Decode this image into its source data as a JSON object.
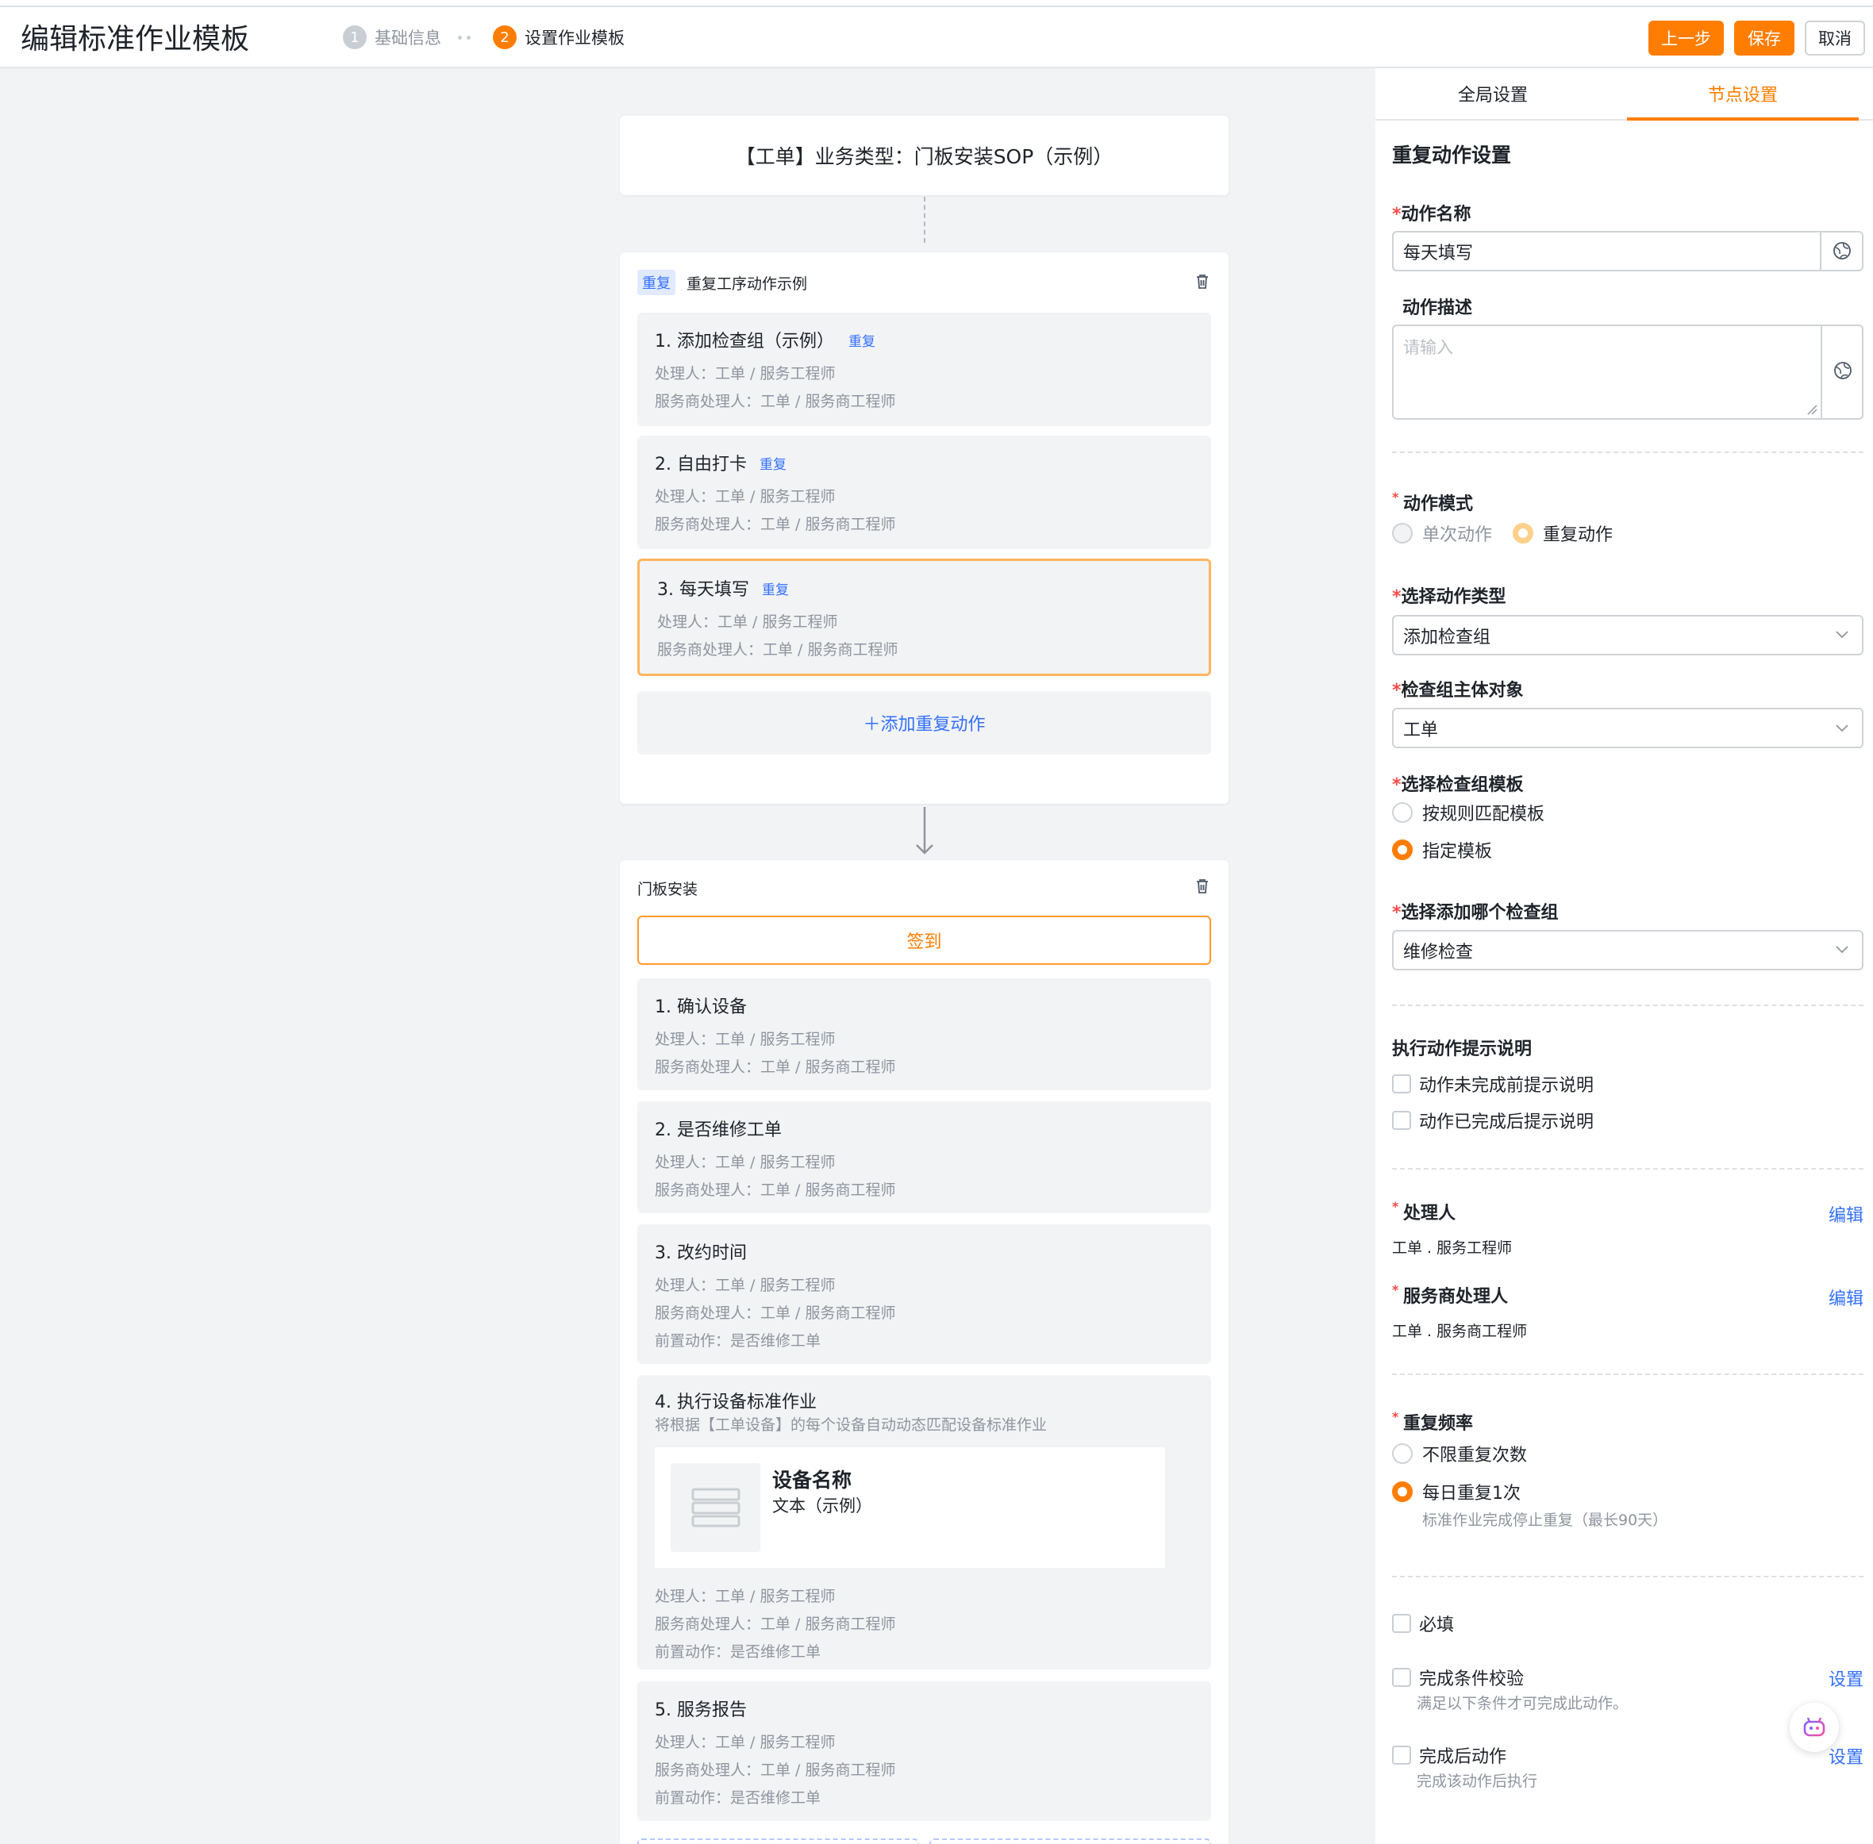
{
  "header": {
    "title": "编辑标准作业模板",
    "steps": [
      {
        "num": "1",
        "label": "基础信息"
      },
      {
        "num": "2",
        "label": "设置作业模板"
      }
    ],
    "prev_label": "上一步",
    "save_label": "保存",
    "cancel_label": "取消"
  },
  "canvas": {
    "start_node": "【工单】业务类型：门板安装SOP（示例）",
    "repeat_stage": {
      "tag": "重复",
      "title": "重复工序动作示例",
      "actions": [
        {
          "title": "1. 添加检查组（示例）",
          "tag": "重复",
          "handler": "处理人：工单 / 服务工程师",
          "sp_handler": "服务商处理人：工单 / 服务商工程师"
        },
        {
          "title": "2. 自由打卡",
          "tag": "重复",
          "handler": "处理人：工单 / 服务工程师",
          "sp_handler": "服务商处理人：工单 / 服务商工程师"
        },
        {
          "title": "3. 每天填写",
          "tag": "重复",
          "handler": "处理人：工单 / 服务工程师",
          "sp_handler": "服务商处理人：工单 / 服务商工程师"
        }
      ],
      "add_label": "＋添加重复动作"
    },
    "install_stage": {
      "title": "门板安装",
      "checkin": "签到",
      "actions": [
        {
          "title": "1. 确认设备",
          "handler": "处理人：工单 / 服务工程师",
          "sp_handler": "服务商处理人：工单 / 服务商工程师"
        },
        {
          "title": "2. 是否维修工单",
          "handler": "处理人：工单 / 服务工程师",
          "sp_handler": "服务商处理人：工单 / 服务商工程师"
        },
        {
          "title": "3. 改约时间",
          "handler": "处理人：工单 / 服务工程师",
          "sp_handler": "服务商处理人：工单 / 服务商工程师",
          "pre": "前置动作：是否维修工单"
        },
        {
          "title": "4. 执行设备标准作业",
          "desc": "将根据【工单设备】的每个设备自动动态匹配设备标准作业",
          "device_name": "设备名称",
          "device_text": "文本（示例）",
          "handler": "处理人：工单 / 服务工程师",
          "sp_handler": "服务商处理人：工单 / 服务商工程师",
          "pre": "前置动作：是否维修工单"
        },
        {
          "title": "5. 服务报告",
          "handler": "处理人：工单 / 服务工程师",
          "sp_handler": "服务商处理人：工单 / 服务商工程师",
          "pre": "前置动作：是否维修工单"
        }
      ]
    }
  },
  "panel": {
    "tabs": [
      "全局设置",
      "节点设置"
    ],
    "section_title": "重复动作设置",
    "action_name_label": "动作名称",
    "action_name_value": "每天填写",
    "action_desc_label": "动作描述",
    "action_desc_placeholder": "请输入",
    "mode_label": "动作模式",
    "mode_options": [
      "单次动作",
      "重复动作"
    ],
    "type_label": "选择动作类型",
    "type_value": "添加检查组",
    "subject_label": "检查组主体对象",
    "subject_value": "工单",
    "template_label": "选择检查组模板",
    "template_options": [
      "按规则匹配模板",
      "指定模板"
    ],
    "which_label": "选择添加哪个检查组",
    "which_value": "维修检查",
    "tips_label": "执行动作提示说明",
    "tips_options": [
      "动作未完成前提示说明",
      "动作已完成后提示说明"
    ],
    "handler_label": "处理人",
    "handler_value": "工单 . 服务工程师",
    "sp_handler_label": "服务商处理人",
    "sp_handler_value": "工单 . 服务商工程师",
    "edit_label": "编辑",
    "freq_label": "重复频率",
    "freq_options": [
      "不限重复次数",
      "每日重复1次"
    ],
    "freq_hint": "标准作业完成停止重复（最长90天）",
    "required_label": "必填",
    "check_label": "完成条件校验",
    "check_hint": "满足以下条件才可完成此动作。",
    "after_label": "完成后动作",
    "after_hint": "完成该动作后执行",
    "set_label": "设置"
  },
  "colors": {
    "accent": "#ff7d00",
    "link": "#3370ff"
  }
}
